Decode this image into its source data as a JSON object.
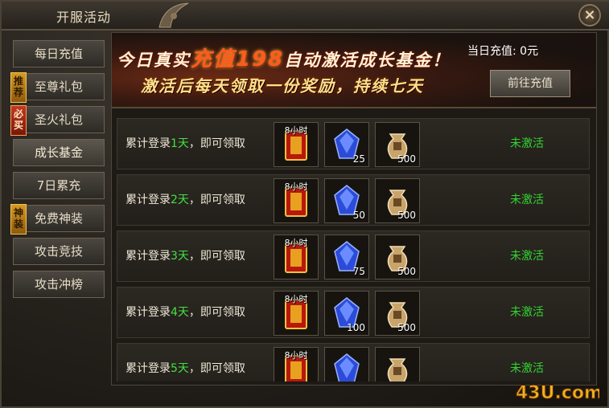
{
  "window": {
    "title": "开服活动",
    "close_label": "×"
  },
  "sidebar": {
    "items": [
      {
        "label": "每日充值",
        "badge": ""
      },
      {
        "label": "至尊礼包",
        "badge": "推荐",
        "badge_color": "gold"
      },
      {
        "label": "圣火礼包",
        "badge": "必买",
        "badge_color": "red"
      },
      {
        "label": "成长基金",
        "badge": "",
        "active": true
      },
      {
        "label": "7日累充",
        "badge": ""
      },
      {
        "label": "免费神装",
        "badge": "神装",
        "badge_color": "gold"
      },
      {
        "label": "攻击竞技",
        "badge": ""
      },
      {
        "label": "攻击冲榜",
        "badge": ""
      }
    ]
  },
  "banner": {
    "line1_prefix": "今日真实",
    "line1_highlight": "充值198",
    "line1_suffix": "自动激活成长基金！",
    "line2": "激活后每天领取一份奖励，持续七天",
    "recharge_label": "当日充值: 0元",
    "goto_button": "前往充值"
  },
  "rows": [
    {
      "prefix": "累计登录",
      "day": "1天",
      "suffix": "，即可领取",
      "item1_tag": "8小时",
      "item1_icon": "five-times-card-icon",
      "item2_icon": "blue-gem-icon",
      "item2_count": "25",
      "item3_icon": "gold-pouch-icon",
      "item3_count": "500",
      "status": "未激活"
    },
    {
      "prefix": "累计登录",
      "day": "2天",
      "suffix": "，即可领取",
      "item1_tag": "8小时",
      "item1_icon": "five-times-card-icon",
      "item2_icon": "blue-gem-icon",
      "item2_count": "50",
      "item3_icon": "gold-pouch-icon",
      "item3_count": "500",
      "status": "未激活"
    },
    {
      "prefix": "累计登录",
      "day": "3天",
      "suffix": "，即可领取",
      "item1_tag": "8小时",
      "item1_icon": "five-times-card-icon",
      "item2_icon": "blue-gem-icon",
      "item2_count": "75",
      "item3_icon": "gold-pouch-icon",
      "item3_count": "500",
      "status": "未激活"
    },
    {
      "prefix": "累计登录",
      "day": "4天",
      "suffix": "，即可领取",
      "item1_tag": "8小时",
      "item1_icon": "five-times-card-icon",
      "item2_icon": "blue-gem-icon",
      "item2_count": "100",
      "item3_icon": "gold-pouch-icon",
      "item3_count": "500",
      "status": "未激活"
    },
    {
      "prefix": "累计登录",
      "day": "5天",
      "suffix": "，即可领取",
      "item1_tag": "8小时",
      "item1_icon": "five-times-card-icon",
      "item2_icon": "blue-gem-icon",
      "item2_count": "",
      "item3_icon": "gold-pouch-icon",
      "item3_count": "",
      "status": "未激活"
    }
  ],
  "watermark": {
    "text": "43U.com"
  },
  "colors": {
    "day_green": "#44e044",
    "status_green": "#32d432",
    "banner_highlight": "#ff5a20",
    "badge_gold": "#d69a22",
    "badge_red": "#c23a22"
  }
}
